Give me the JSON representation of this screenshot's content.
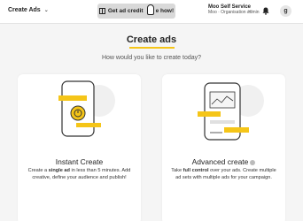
{
  "topbar": {
    "brand_label": "Create Ads",
    "promo_label": "Get ad credit",
    "promo_label_tail": "e how!",
    "account_name": "Moo Self Service",
    "account_org": "Moo · Organisation admin",
    "avatar_initial": "g"
  },
  "main": {
    "title": "Create ads",
    "subtitle": "How would you like to create today?"
  },
  "cards": [
    {
      "title": "Instant Create",
      "desc_pre": "Create a ",
      "desc_bold": "single ad",
      "desc_post": " in less than 5 minutes. Add creative, define your audience and publish!"
    },
    {
      "title": "Advanced create",
      "desc_pre": "Take ",
      "desc_bold": "full control",
      "desc_post": " over your ads. Create multiple ad sets with multiple ads for your campaign."
    }
  ],
  "colors": {
    "accent": "#f5c518",
    "background": "#f5f5f5"
  }
}
